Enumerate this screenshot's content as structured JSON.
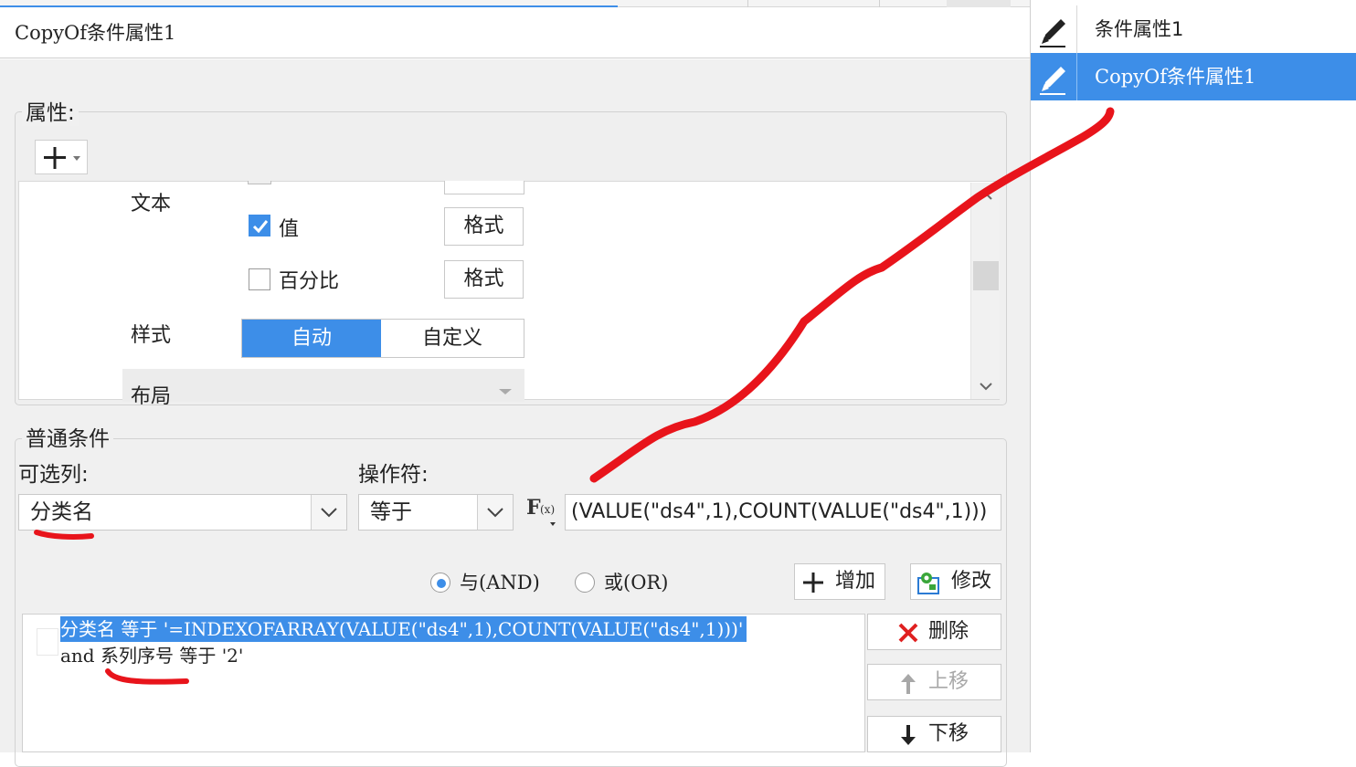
{
  "editor": {
    "name_value": "CopyOf条件属性1"
  },
  "right_panel": {
    "items": [
      {
        "label": "条件属性1",
        "icon": "pencil-icon",
        "selected": false
      },
      {
        "label": "CopyOf条件属性1",
        "icon": "pencil-icon",
        "selected": true
      }
    ]
  },
  "properties": {
    "title": "属性:",
    "add_icon": "plus-icon",
    "text_label": "文本",
    "value_checkbox": {
      "label": "值",
      "checked": true,
      "format_button": "格式"
    },
    "percent_checkbox": {
      "label": "百分比",
      "checked": false,
      "format_button": "格式"
    },
    "style_label": "样式",
    "style_options": [
      "自动",
      "自定义"
    ],
    "style_selected": "自动",
    "layout_label": "布局"
  },
  "condition": {
    "title": "普通条件",
    "column_label": "可选列:",
    "column_value": "分类名",
    "operator_label": "操作符:",
    "operator_value": "等于",
    "formula_icon": "fx-icon",
    "formula_value": "(VALUE(\"ds4\",1),COUNT(VALUE(\"ds4\",1)))",
    "and_label": "与(AND)",
    "or_label": "或(OR)",
    "and_selected": true,
    "add_button": "增加",
    "modify_button": "修改",
    "delete_button": "删除",
    "up_button": "上移",
    "down_button": "下移",
    "lines": [
      {
        "highlighted": true,
        "field": "分类名",
        "op": "等于",
        "value": "'=INDEXOFARRAY(VALUE(\"ds4\",1),COUNT(VALUE(\"ds4\",1)))'"
      },
      {
        "prefix": "and",
        "field": "系列序号",
        "op": "等于",
        "value": "'2'"
      }
    ]
  },
  "colors": {
    "accent": "#3d8ee8",
    "annotation": "#e8141b",
    "delete_x": "#e02020"
  }
}
